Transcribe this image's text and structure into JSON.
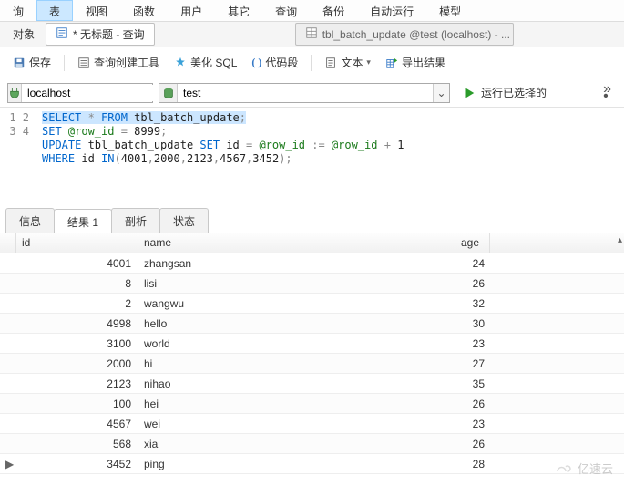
{
  "menubar": [
    "询",
    "表",
    "视图",
    "函数",
    "用户",
    "其它",
    "查询",
    "备份",
    "自动运行",
    "模型"
  ],
  "menubar_active_index": 1,
  "pane_label": "对象",
  "doc_tabs": [
    {
      "title": "* 无标题 - 查询",
      "active": true
    },
    {
      "title": "tbl_batch_update @test (localhost) - ...",
      "active": false
    }
  ],
  "toolbar": {
    "save": "保存",
    "query_builder": "查询创建工具",
    "beautify_sql": "美化 SQL",
    "code_snippet": "代码段",
    "text": "文本",
    "export": "导出结果"
  },
  "connection": {
    "server": "localhost",
    "database": "test",
    "run_label": "运行已选择的"
  },
  "code": {
    "line_numbers": [
      "1",
      "2",
      "3",
      "4"
    ],
    "tokens": [
      [
        [
          "kw sel",
          "SELECT"
        ],
        [
          "op sel",
          " * "
        ],
        [
          "kw sel",
          "FROM"
        ],
        [
          "tbl sel",
          " tbl_batch_update"
        ],
        [
          "op sel",
          ";"
        ]
      ],
      [
        [
          "kw",
          "SET"
        ],
        [
          "id",
          " @row_id"
        ],
        [
          "op",
          " = "
        ],
        [
          "num",
          "8999"
        ],
        [
          "op",
          ";"
        ]
      ],
      [
        [
          "kw",
          "UPDATE"
        ],
        [
          "tbl",
          " tbl_batch_update "
        ],
        [
          "kw",
          "SET"
        ],
        [
          "tbl",
          " id "
        ],
        [
          "op",
          "= "
        ],
        [
          "id",
          "@row_id"
        ],
        [
          "op",
          " := "
        ],
        [
          "id",
          "@row_id"
        ],
        [
          "op",
          " + "
        ],
        [
          "num",
          "1"
        ]
      ],
      [
        [
          "kw",
          "WHERE"
        ],
        [
          "tbl",
          " id "
        ],
        [
          "kw",
          "IN"
        ],
        [
          "op",
          "("
        ],
        [
          "num",
          "4001"
        ],
        [
          "op",
          ","
        ],
        [
          "num",
          "2000"
        ],
        [
          "op",
          ","
        ],
        [
          "num",
          "2123"
        ],
        [
          "op",
          ","
        ],
        [
          "num",
          "4567"
        ],
        [
          "op",
          ","
        ],
        [
          "num",
          "3452"
        ],
        [
          "op",
          ");"
        ]
      ]
    ]
  },
  "result_tabs": [
    "信息",
    "结果 1",
    "剖析",
    "状态"
  ],
  "result_tab_active": 1,
  "columns": [
    "id",
    "name",
    "age"
  ],
  "rows": [
    {
      "id": 4001,
      "name": "zhangsan",
      "age": 24,
      "marker": ""
    },
    {
      "id": 8,
      "name": "lisi",
      "age": 26,
      "marker": ""
    },
    {
      "id": 2,
      "name": "wangwu",
      "age": 32,
      "marker": ""
    },
    {
      "id": 4998,
      "name": "hello",
      "age": 30,
      "marker": ""
    },
    {
      "id": 3100,
      "name": "world",
      "age": 23,
      "marker": ""
    },
    {
      "id": 2000,
      "name": "hi",
      "age": 27,
      "marker": ""
    },
    {
      "id": 2123,
      "name": "nihao",
      "age": 35,
      "marker": ""
    },
    {
      "id": 100,
      "name": "hei",
      "age": 26,
      "marker": ""
    },
    {
      "id": 4567,
      "name": "wei",
      "age": 23,
      "marker": ""
    },
    {
      "id": 568,
      "name": "xia",
      "age": 26,
      "marker": ""
    },
    {
      "id": 3452,
      "name": "ping",
      "age": 28,
      "marker": "▶"
    }
  ],
  "watermark": "亿速云"
}
